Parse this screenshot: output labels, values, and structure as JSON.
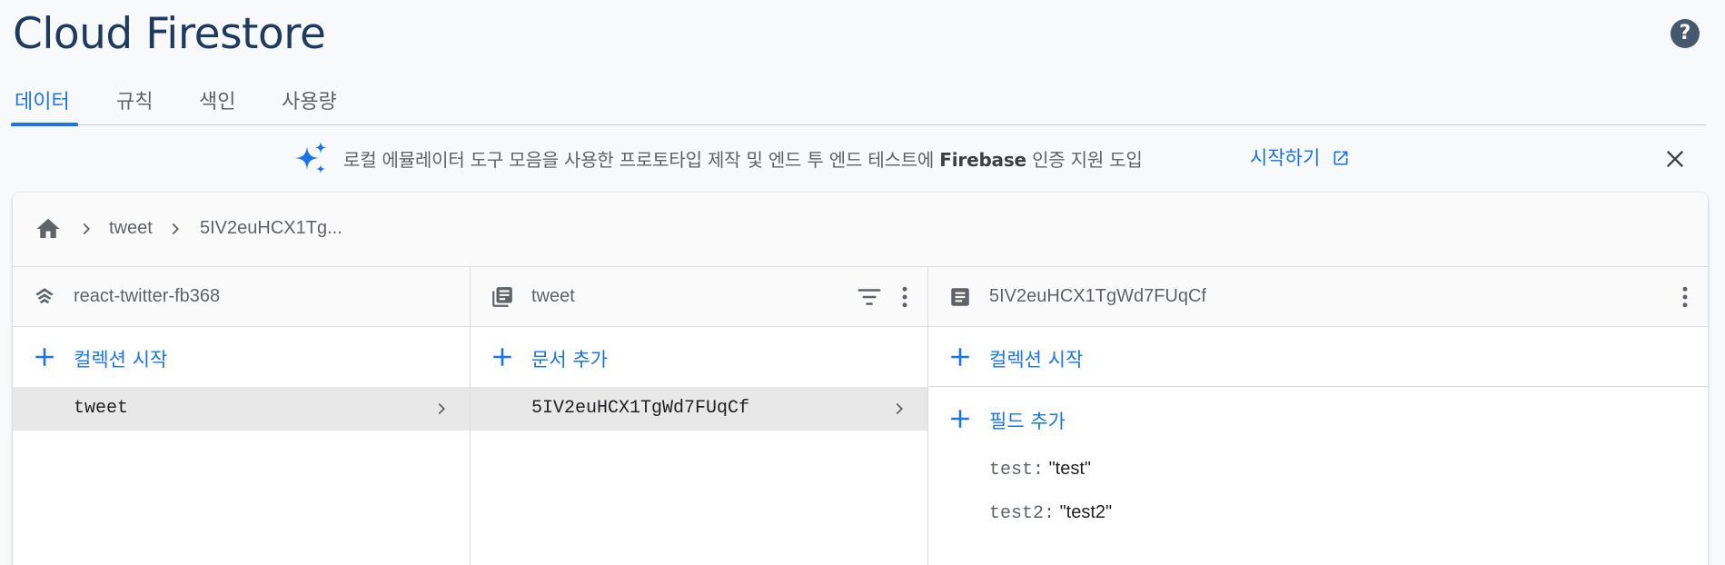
{
  "header": {
    "title": "Cloud Firestore",
    "help_icon": "help-icon"
  },
  "tabs": [
    {
      "label": "데이터",
      "active": true
    },
    {
      "label": "규칙",
      "active": false
    },
    {
      "label": "색인",
      "active": false
    },
    {
      "label": "사용량",
      "active": false
    }
  ],
  "banner": {
    "text_before": "로컬 에뮬레이터 도구 모음을 사용한 프로토타입 제작 및 엔드 투 엔드 테스트에 ",
    "text_bold": "Firebase",
    "text_after": " 인증 지원 도입",
    "link_label": "시작하기"
  },
  "breadcrumb": {
    "items": [
      "tweet",
      "5IV2euHCX1Tg..."
    ]
  },
  "columns": {
    "root": {
      "title": "react-twitter-fb368",
      "add_label": "컬렉션 시작",
      "items": [
        "tweet"
      ]
    },
    "collection": {
      "title": "tweet",
      "add_label": "문서 추가",
      "items": [
        "5IV2euHCX1TgWd7FUqCf"
      ]
    },
    "document": {
      "title": "5IV2euHCX1TgWd7FUqCf",
      "add_collection_label": "컬렉션 시작",
      "add_field_label": "필드 추가",
      "fields": [
        {
          "key": "test:",
          "value": "\"test\""
        },
        {
          "key": "test2:",
          "value": "\"test2\""
        }
      ]
    }
  },
  "colors": {
    "accent": "#1a73e8",
    "title": "#1f3a5f"
  }
}
